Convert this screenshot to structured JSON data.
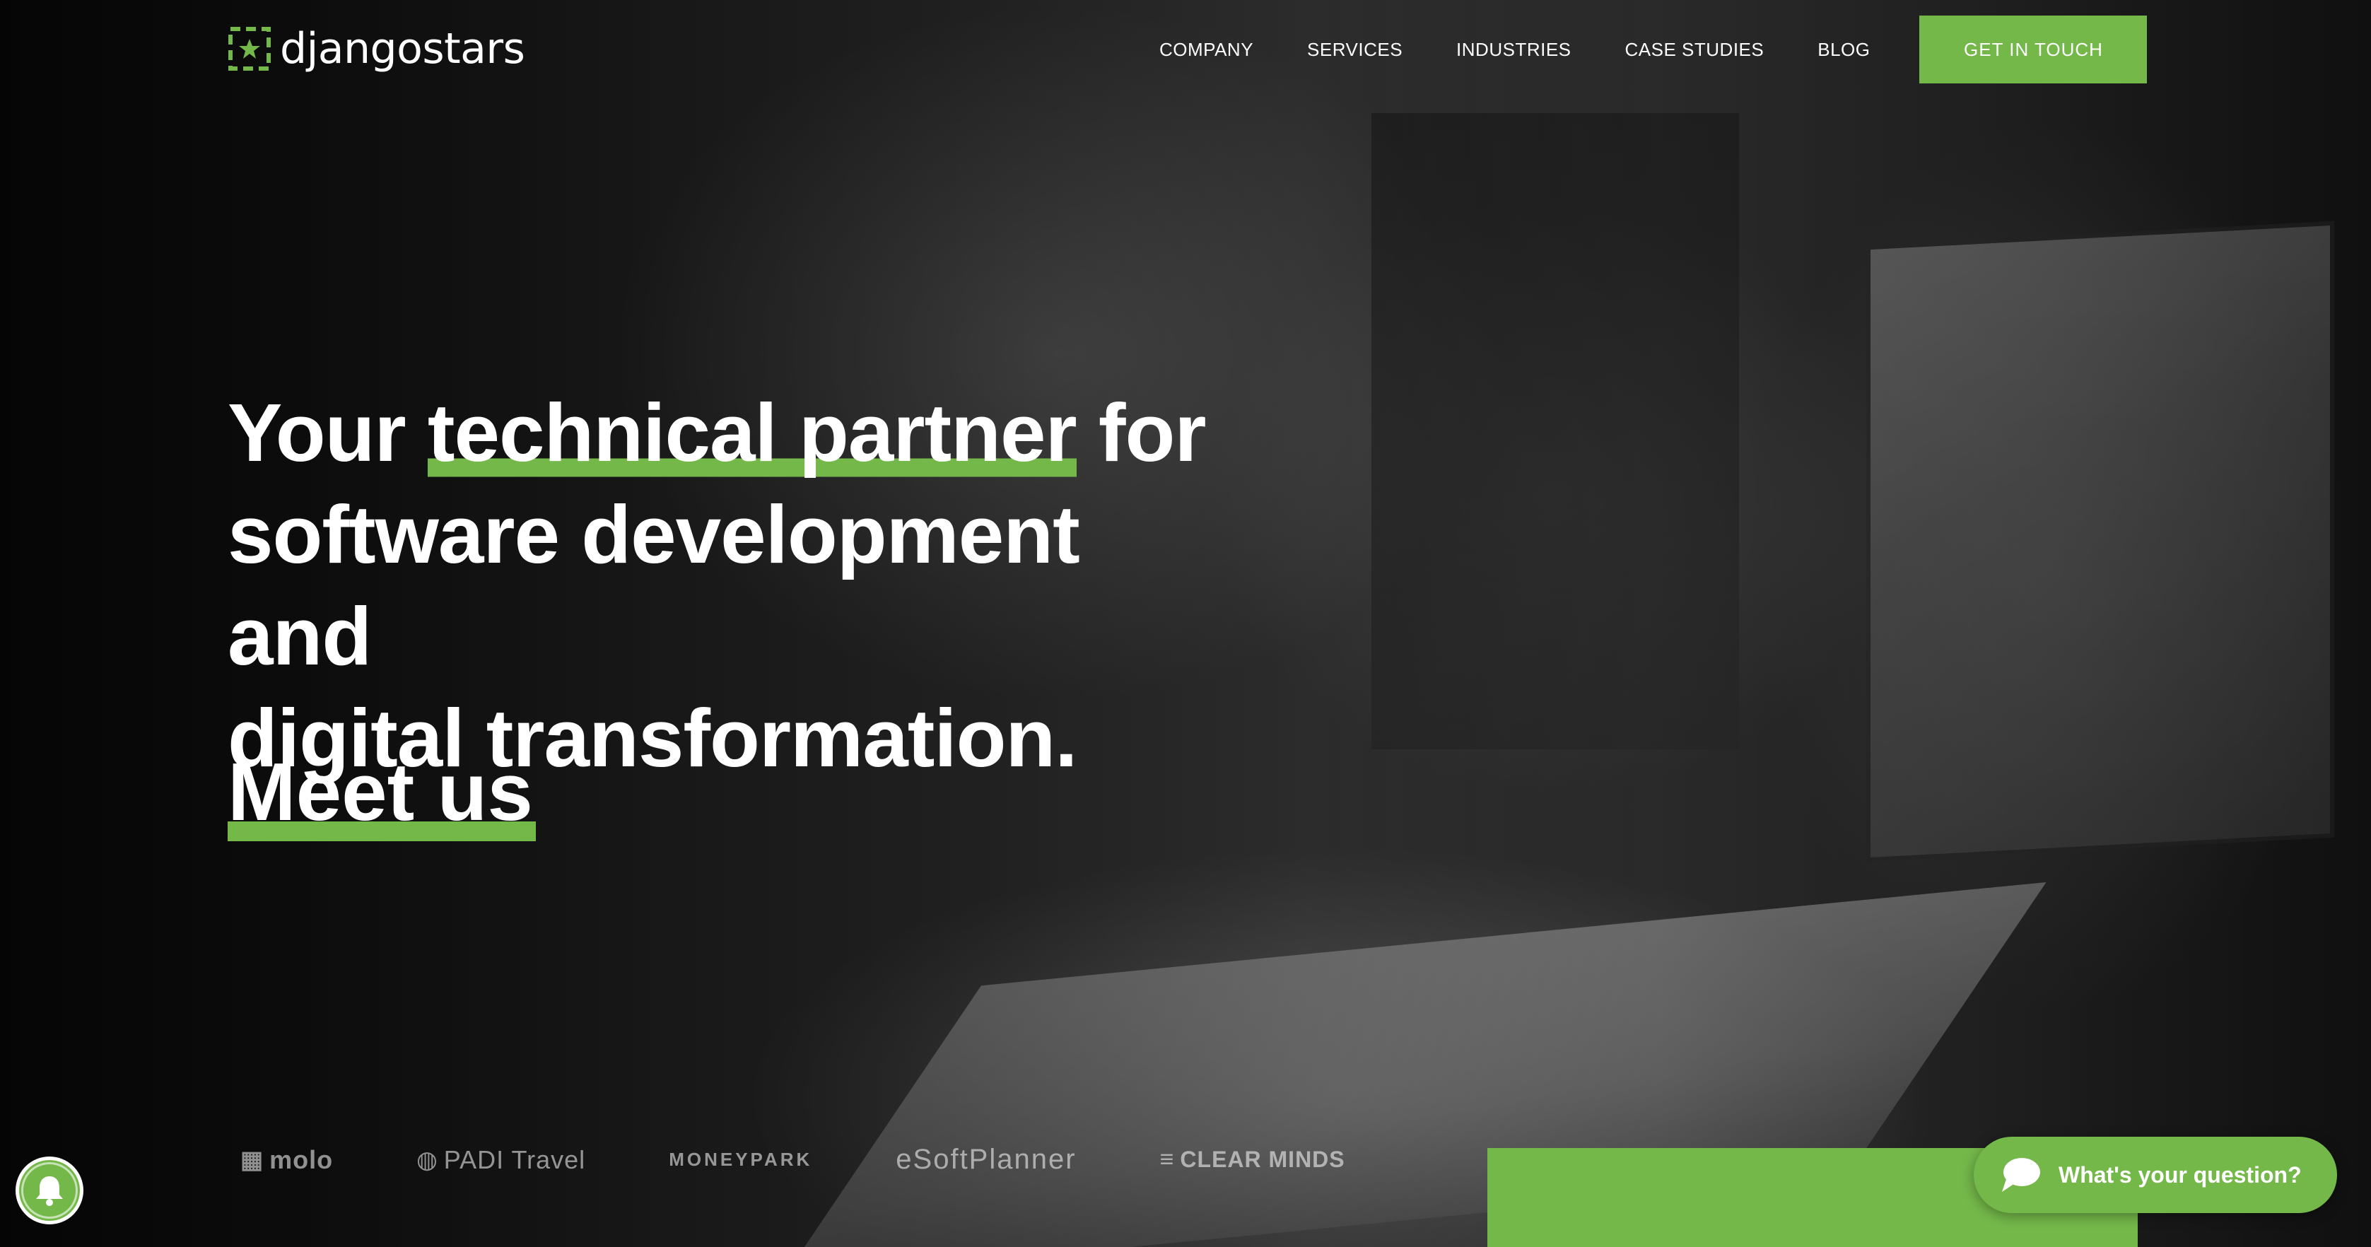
{
  "brand": {
    "name": "djangostars",
    "accent_color": "#74b84a"
  },
  "nav": {
    "items": [
      {
        "label": "COMPANY"
      },
      {
        "label": "SERVICES"
      },
      {
        "label": "INDUSTRIES"
      },
      {
        "label": "CASE STUDIES"
      },
      {
        "label": "BLOG"
      }
    ],
    "cta_label": "GET IN TOUCH"
  },
  "hero": {
    "line1_prefix": "Your ",
    "line1_highlight": "technical partner",
    "line1_suffix": " for",
    "line2": "software development and",
    "line3": "digital transformation.",
    "meet_link": "Meet us"
  },
  "clients": [
    {
      "name": "molo",
      "icon": "molo-cube-icon"
    },
    {
      "name": "PADI Travel",
      "icon": "globe-icon"
    },
    {
      "name": "MONEYPARK",
      "icon": "leaf-icon"
    },
    {
      "name": "eSoftPlanner",
      "icon": ""
    },
    {
      "name": "CLEAR MINDS",
      "icon": "lines-icon"
    }
  ],
  "chat": {
    "label": "What's your question?"
  },
  "notification": {
    "icon": "bell-icon"
  }
}
